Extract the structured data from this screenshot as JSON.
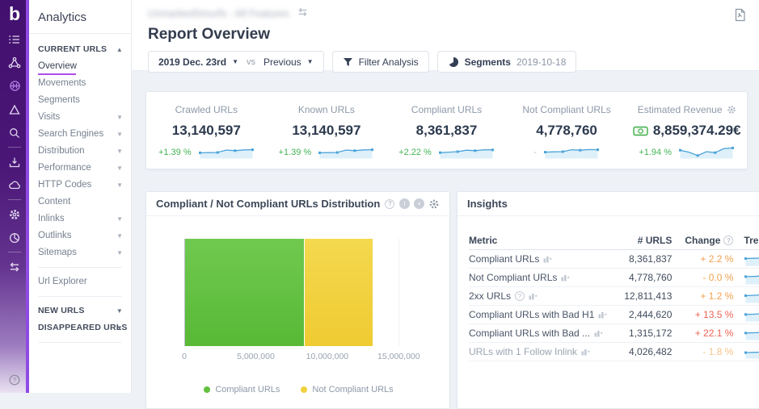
{
  "colors": {
    "accent_purple": "#b04ce8",
    "green": "#42b554",
    "grey_dash": "#b6bcc6",
    "orange": "#f0a04e",
    "red": "#ee6352",
    "pale_orange": "#f5c38a",
    "bar_green": "#62c13d",
    "bar_yellow": "#f2d13e",
    "spark_line": "#4aa3d8",
    "spark_fill": "#def0fa"
  },
  "rail": {
    "logo": "b"
  },
  "sidebar": {
    "title": "Analytics",
    "items": [
      {
        "label": "CURRENT URLS"
      },
      {
        "label": "Overview"
      },
      {
        "label": "Movements"
      },
      {
        "label": "Segments"
      },
      {
        "label": "Visits"
      },
      {
        "label": "Search Engines"
      },
      {
        "label": "Distribution"
      },
      {
        "label": "Performance"
      },
      {
        "label": "HTTP Codes"
      },
      {
        "label": "Content"
      },
      {
        "label": "Inlinks"
      },
      {
        "label": "Outlinks"
      },
      {
        "label": "Sitemaps"
      },
      {
        "label": "Url Explorer"
      },
      {
        "label": "NEW URLS"
      },
      {
        "label": "DISAPPEARED URLS"
      }
    ]
  },
  "header": {
    "project_name": "UnmarkedSmurfs - All Features",
    "page_title": "Report Overview",
    "controls": {
      "date_primary": "2019 Dec. 23rd",
      "vs_label": "vs",
      "date_compare": "Previous",
      "filter_label": "Filter Analysis",
      "segments_label": "Segments",
      "segments_date": "2019-10-18"
    }
  },
  "kpis": [
    {
      "label": "Crawled URLs",
      "value": "13,140,597",
      "change": "+1.39 %",
      "change_color": "#42b554",
      "spark": [
        0.62,
        0.6,
        0.58,
        0.33,
        0.4,
        0.32,
        0.3
      ]
    },
    {
      "label": "Known URLs",
      "value": "13,140,597",
      "change": "+1.39 %",
      "change_color": "#42b554",
      "spark": [
        0.62,
        0.6,
        0.58,
        0.33,
        0.4,
        0.32,
        0.3
      ]
    },
    {
      "label": "Compliant URLs",
      "value": "8,361,837",
      "change": "+2.22 %",
      "change_color": "#42b554",
      "spark": [
        0.6,
        0.55,
        0.5,
        0.35,
        0.4,
        0.3,
        0.32
      ]
    },
    {
      "label": "Not Compliant URLs",
      "value": "4,778,760",
      "change": "-",
      "change_color": "#b6bcc6",
      "spark": [
        0.55,
        0.52,
        0.5,
        0.3,
        0.35,
        0.28,
        0.3
      ]
    },
    {
      "label": "Estimated Revenue",
      "value": "8,859,374.29€",
      "change": "+1.94 %",
      "change_color": "#42b554",
      "spark": [
        0.35,
        0.55,
        0.9,
        0.5,
        0.6,
        0.18,
        0.12
      ]
    }
  ],
  "distribution_panel": {
    "title": "Compliant / Not Compliant URLs Distribution",
    "chart_data": {
      "type": "bar",
      "orientation": "horizontal",
      "stacked": true,
      "series": [
        {
          "name": "Compliant URLs",
          "value": 8361837,
          "color": "#62c13d"
        },
        {
          "name": "Not Compliant URLs",
          "value": 4778760,
          "color": "#f2d13e"
        }
      ],
      "axis_max": 16000000,
      "tick_values": [
        0,
        5000000,
        10000000,
        15000000
      ],
      "tick_labels": [
        "0",
        "5,000,000",
        "10,000,000",
        "15,000,000"
      ],
      "grid": true,
      "legend_position": "bottom"
    }
  },
  "insights": {
    "title": "Insights",
    "columns": {
      "metric": "Metric",
      "urls": "# URLS",
      "change": "Change",
      "trend": "Trend"
    },
    "rows": [
      {
        "metric": "Compliant URLs",
        "urls": "8,361,837",
        "change": "+ 2.2 %",
        "change_color": "#f0a04e",
        "spark": [
          0.5,
          0.48,
          0.45,
          0.22,
          0.3,
          0.35,
          0.32,
          0.25
        ]
      },
      {
        "metric": "Not Compliant URLs",
        "urls": "4,778,760",
        "change": "- 0.0 %",
        "change_color": "#f0a04e",
        "spark": [
          0.45,
          0.44,
          0.4,
          0.28,
          0.3,
          0.26,
          0.3,
          0.27
        ]
      },
      {
        "metric": "2xx URLs",
        "urls": "12,811,413",
        "change": "+ 1.2 %",
        "change_color": "#f0a04e",
        "spark": [
          0.5,
          0.47,
          0.42,
          0.3,
          0.24,
          0.3,
          0.28,
          0.25
        ]
      },
      {
        "metric": "Compliant URLs with Bad H1",
        "urls": "2,444,620",
        "change": "+ 13.5 %",
        "change_color": "#ee6352",
        "spark": [
          0.52,
          0.5,
          0.46,
          0.28,
          0.26,
          0.36,
          0.3,
          0.15
        ]
      },
      {
        "metric": "Compliant URLs with Bad ...",
        "urls": "1,315,172",
        "change": "+ 22.1 %",
        "change_color": "#ee6352",
        "spark": [
          0.52,
          0.5,
          0.48,
          0.34,
          0.3,
          0.36,
          0.3,
          0.18
        ]
      },
      {
        "metric": "URLs with 1 Follow Inlink",
        "urls": "4,026,482",
        "change": "- 1.8 %",
        "change_color": "#f5c38a",
        "spark": [
          0.62,
          0.6,
          0.58,
          0.56,
          0.28,
          0.3,
          0.28,
          0.3
        ]
      }
    ]
  }
}
